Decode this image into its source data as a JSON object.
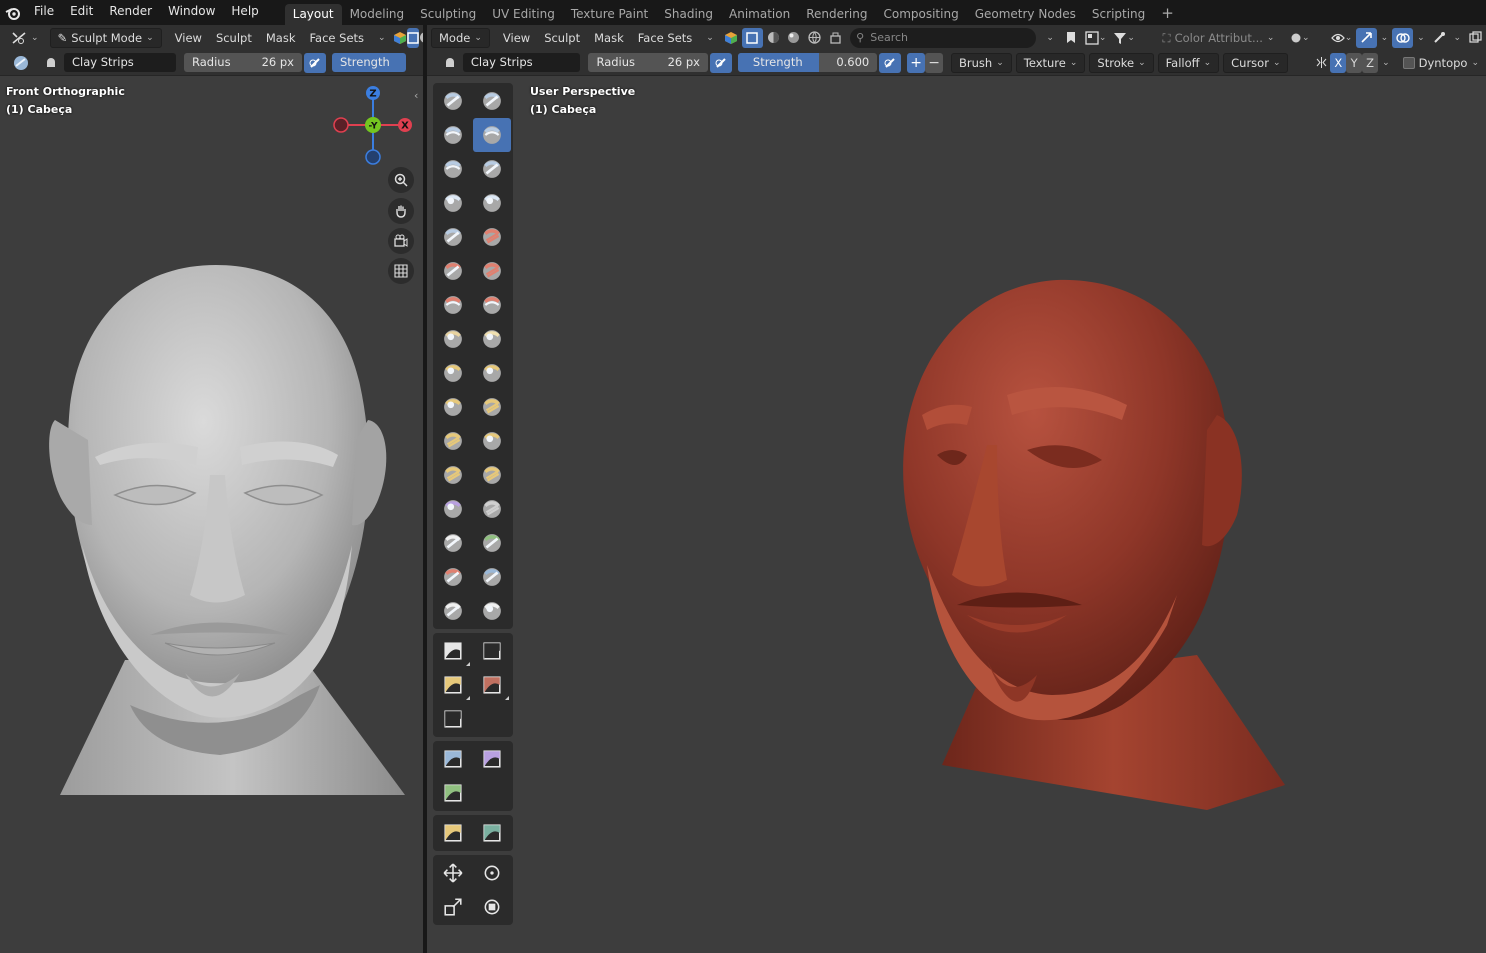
{
  "topbar": {
    "menus": [
      "File",
      "Edit",
      "Render",
      "Window",
      "Help"
    ],
    "workspaces": [
      "Layout",
      "Modeling",
      "Sculpting",
      "UV Editing",
      "Texture Paint",
      "Shading",
      "Animation",
      "Rendering",
      "Compositing",
      "Geometry Nodes",
      "Scripting"
    ],
    "active_workspace": "Layout",
    "add_label": "+"
  },
  "left_view": {
    "header": {
      "mode": "Sculpt Mode",
      "menus": [
        "View",
        "Sculpt",
        "Mask",
        "Face Sets"
      ]
    },
    "tool_settings": {
      "brush_name": "Clay Strips",
      "radius_label": "Radius",
      "radius_value": "26 px",
      "strength_label": "Strength"
    },
    "overlay": {
      "view_name": "Front Orthographic",
      "object_name": "(1) Cabeça"
    },
    "gizmo": {
      "z": "Z",
      "y": "-Y",
      "x": "X"
    },
    "mesh_color": "#b9b9b9"
  },
  "right_view": {
    "header": {
      "mode": "Mode",
      "menus": [
        "View",
        "Sculpt",
        "Mask",
        "Face Sets"
      ],
      "search_placeholder": "Search",
      "color_attribute": "Color Attribut..."
    },
    "tool_settings": {
      "brush_name": "Clay Strips",
      "radius_label": "Radius",
      "radius_value": "26 px",
      "strength_label": "Strength",
      "strength_value": "0.600",
      "dropdowns": [
        "Brush",
        "Texture",
        "Stroke",
        "Falloff",
        "Cursor"
      ],
      "axes": [
        "X",
        "Y",
        "Z"
      ],
      "dyntopo_label": "Dyntopo"
    },
    "overlay": {
      "view_name": "User Perspective",
      "object_name": "(1) Cabeça"
    },
    "mesh_color": "#8c3426"
  },
  "colors": {
    "accent": "#4772b3",
    "viewport_bg": "#3d3d3d",
    "header_bg": "#303030",
    "topbar_bg": "#181818"
  }
}
